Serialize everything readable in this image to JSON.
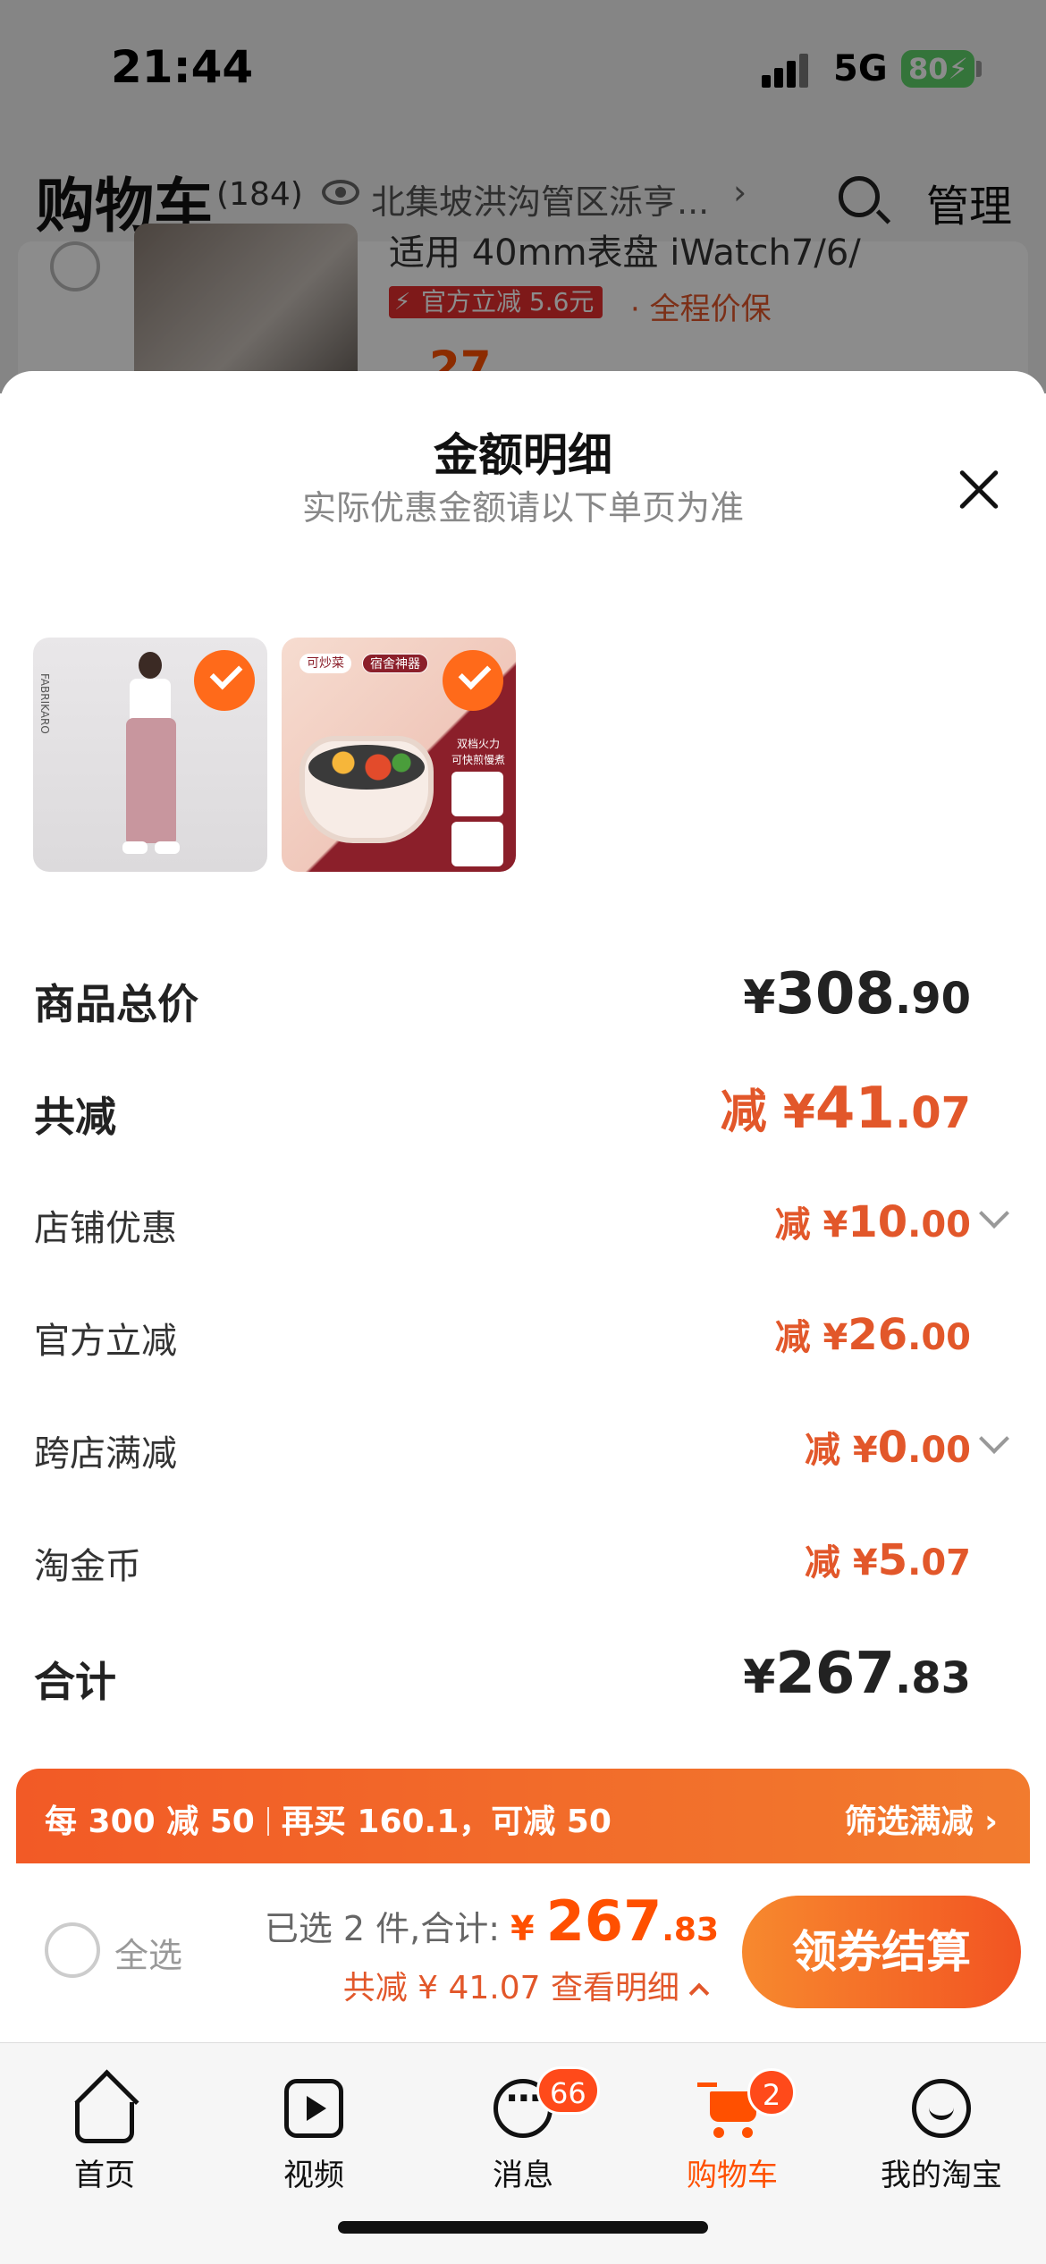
{
  "status_bar": {
    "time": "21:44",
    "network": "5G",
    "battery": "80"
  },
  "header": {
    "title": "购物车",
    "count": "(184)",
    "location": "北集坡洪沟管区泺亨...",
    "manage": "管理",
    "icons": [
      "eye-icon",
      "search-icon"
    ]
  },
  "background_item": {
    "title_partial": "适用 40mm表盘 iWatch7/6/",
    "tag": "官方立减 5.6元",
    "guarantee": "· 全程价保",
    "price_partial": "27."
  },
  "sheet": {
    "title": "金额明细",
    "subtitle": "实际优惠金额请以下单页为准",
    "thumbnail_chips": [
      "可炒菜",
      "宿舍神器"
    ],
    "thumbnail_side_text": "双档火力 可快煎慢煮",
    "rows": {
      "total_price": {
        "label": "商品总价",
        "prefix": "",
        "symbol": "¥",
        "int": "308",
        "dec": ".90"
      },
      "total_discount": {
        "label": "共减",
        "prefix": "减 ",
        "symbol": "¥",
        "int": "41",
        "dec": ".07"
      },
      "store_discount": {
        "label": "店铺优惠",
        "prefix": "减 ",
        "symbol": "¥",
        "int": "10",
        "dec": ".00"
      },
      "official_discount": {
        "label": "官方立减",
        "prefix": "减 ",
        "symbol": "¥",
        "int": "26",
        "dec": ".00"
      },
      "cross_store": {
        "label": "跨店满减",
        "prefix": "减 ",
        "symbol": "¥",
        "int": "0",
        "dec": ".00"
      },
      "coins": {
        "label": "淘金币",
        "prefix": "减 ",
        "symbol": "¥",
        "int": "5",
        "dec": ".07"
      },
      "subtotal": {
        "label": "合计",
        "prefix": "",
        "symbol": "¥",
        "int": "267",
        "dec": ".83"
      }
    }
  },
  "promo": {
    "part1": "每 300 减 50",
    "part2": "再买 160.1，可减 50",
    "action": "筛选满减 ›"
  },
  "checkout": {
    "select_all": "全选",
    "selected_text": "已选 2 件,合计: ",
    "symbol": "¥ ",
    "int": "267",
    "dec": ".83",
    "discount_text": "共减 ¥ 41.07  查看明细",
    "pay_button": "领券结算"
  },
  "tabbar": {
    "tabs": [
      {
        "label": "首页",
        "icon": "home-icon"
      },
      {
        "label": "视频",
        "icon": "video-icon"
      },
      {
        "label": "消息",
        "icon": "message-icon",
        "badge": "66"
      },
      {
        "label": "购物车",
        "icon": "cart-icon",
        "badge": "2",
        "active": true
      },
      {
        "label": "我的淘宝",
        "icon": "profile-icon"
      }
    ]
  },
  "colors": {
    "accent": "#ff5000",
    "discount": "#e2572a",
    "promo_start": "#f25a26",
    "promo_end": "#f27b2e"
  }
}
